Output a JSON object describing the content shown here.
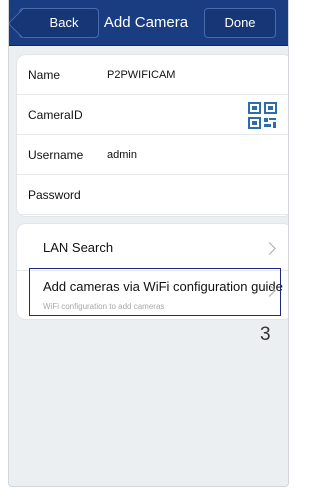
{
  "header": {
    "back_label": "Back",
    "title": "Add Camera",
    "done_label": "Done"
  },
  "form": {
    "name_label": "Name",
    "name_value": "P2PWIFICAM",
    "camera_id_label": "CameraID",
    "camera_id_icon": "qr-code-icon",
    "username_label": "Username",
    "username_value": "admin",
    "password_label": "Password"
  },
  "actions": {
    "lan_search_label": "LAN Search",
    "wifi_guide_label": "Add cameras via WiFi configuration guide",
    "wifi_guide_subtitle": "WiFi configuration to add cameras",
    "chevron_icon": "chevron-right-icon"
  },
  "annotation": {
    "number": "3",
    "highlight_color": "#1d2b7a"
  },
  "colors": {
    "navbar": "#1a3d82",
    "button_border": "#4a6aad",
    "page_background": "#eceff1",
    "card_background": "#ffffff",
    "qr_icon": "#2f6da8"
  }
}
